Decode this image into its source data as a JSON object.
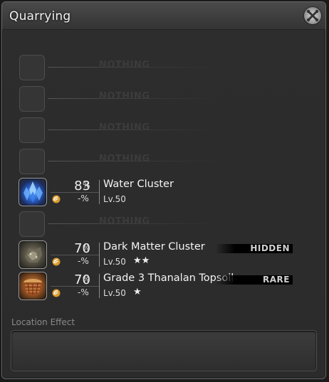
{
  "window": {
    "title": "Quarrying",
    "close_icon": "close-icon"
  },
  "empty_label": "NOTHING",
  "slots": [
    {
      "type": "empty"
    },
    {
      "type": "empty"
    },
    {
      "type": "empty"
    },
    {
      "type": "empty"
    },
    {
      "type": "item",
      "name": "Water Cluster",
      "percent": "83",
      "percent_unit": "%",
      "secondary_percent": "-%",
      "level": "Lv.50",
      "stars": "",
      "tag": "",
      "icon": "water-cluster-icon"
    },
    {
      "type": "empty"
    },
    {
      "type": "item",
      "name": "Dark Matter Cluster",
      "percent": "70",
      "percent_unit": "%",
      "secondary_percent": "-%",
      "level": "Lv.50",
      "stars": "★★",
      "tag": "HIDDEN",
      "icon": "dark-matter-cluster-icon"
    },
    {
      "type": "item",
      "name": "Grade 3 Thanalan Topsoil",
      "percent": "70",
      "percent_unit": "%",
      "secondary_percent": "-%",
      "level": "Lv.50",
      "stars": "★",
      "tag": "RARE",
      "icon": "topsoil-icon"
    }
  ],
  "location_effect": {
    "label": "Location Effect",
    "value": ""
  },
  "colors": {
    "window_bg": "#2d2d2d",
    "text": "#f0f0f0",
    "empty_text": "#3c3c3c",
    "tag_bg": "#000000"
  }
}
